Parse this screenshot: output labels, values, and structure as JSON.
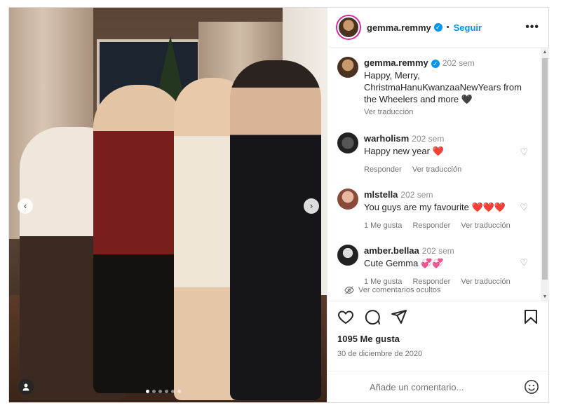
{
  "post": {
    "author": "gemma.remmy",
    "follow_label": "Seguir",
    "more_label": "•••",
    "caption_time": "202 sem",
    "caption": "Happy, Merry, ChristmaHanuKwanzaaNewYears from the Wheelers and more",
    "caption_emoji": "🖤",
    "translate_label": "Ver traducción",
    "likes": "1095 Me gusta",
    "date": "30 de diciembre de 2020",
    "carousel": {
      "slides": 6,
      "active_index": 0
    }
  },
  "comments": [
    {
      "user": "warholism",
      "time": "202 sem",
      "text": "Happy new year",
      "emoji": "❤️",
      "reply_label": "Responder",
      "translate_label": "Ver traducción",
      "likes_label": ""
    },
    {
      "user": "mlstella",
      "time": "202 sem",
      "text": "You guys are my favourite",
      "emoji": "❤️❤️❤️",
      "likes_label": "1 Me gusta",
      "reply_label": "Responder",
      "translate_label": "Ver traducción"
    },
    {
      "user": "amber.bellaa",
      "time": "202 sem",
      "text": "Cute Gemma",
      "emoji": "💞💞",
      "likes_label": "1 Me gusta",
      "reply_label": "Responder",
      "translate_label": "Ver traducción"
    }
  ],
  "hidden_comments_label": "Ver comentarios ocultos",
  "add_comment": {
    "placeholder": "Añade un comentario..."
  },
  "colors": {
    "link": "#0095f6",
    "heart": "#ed4956",
    "muted": "#737373"
  },
  "icons": [
    "chevron-left-icon",
    "chevron-right-icon",
    "tag-user-icon",
    "verified-icon",
    "heart-icon",
    "comment-icon",
    "share-icon",
    "bookmark-icon",
    "eye-off-icon",
    "emoji-icon"
  ]
}
